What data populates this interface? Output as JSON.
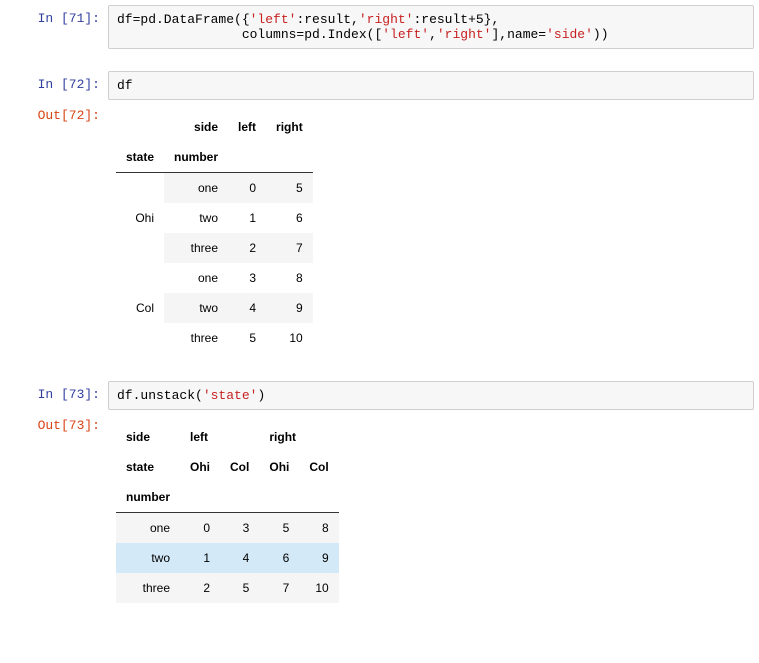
{
  "cells": {
    "in71": {
      "label": "In  [71]:"
    },
    "in72": {
      "label": "In  [72]:"
    },
    "out72": {
      "label": "Out[72]:"
    },
    "in73": {
      "label": "In  [73]:"
    },
    "out73": {
      "label": "Out[73]:"
    }
  },
  "code71": {
    "p1": "df=pd.DataFrame({",
    "s1": "'left'",
    "p2": ":result,",
    "s2": "'right'",
    "p3": ":result+5},",
    "indent": "                columns=pd.Index([",
    "s3": "'left'",
    "p4": ",",
    "s4": "'right'",
    "p5": "],name=",
    "s5": "'side'",
    "p6": "))"
  },
  "code72": {
    "p1": "df"
  },
  "code73": {
    "p1": "df.unstack(",
    "s1": "'state'",
    "p2": ")"
  },
  "table72": {
    "h_side": "side",
    "h_left": "left",
    "h_right": "right",
    "h_state": "state",
    "h_number": "number",
    "states": [
      "Ohi",
      "Col"
    ],
    "numbers": [
      "one",
      "two",
      "three"
    ],
    "rows": [
      {
        "left": "0",
        "right": "5"
      },
      {
        "left": "1",
        "right": "6"
      },
      {
        "left": "2",
        "right": "7"
      },
      {
        "left": "3",
        "right": "8"
      },
      {
        "left": "4",
        "right": "9"
      },
      {
        "left": "5",
        "right": "10"
      }
    ]
  },
  "table73": {
    "h_side": "side",
    "h_left": "left",
    "h_right": "right",
    "h_state": "state",
    "h_number": "number",
    "states": [
      "Ohi",
      "Col"
    ],
    "numbers": [
      "one",
      "two",
      "three"
    ],
    "rows": [
      {
        "c1": "0",
        "c2": "3",
        "c3": "5",
        "c4": "8"
      },
      {
        "c1": "1",
        "c2": "4",
        "c3": "6",
        "c4": "9"
      },
      {
        "c1": "2",
        "c2": "5",
        "c3": "7",
        "c4": "10"
      }
    ]
  }
}
